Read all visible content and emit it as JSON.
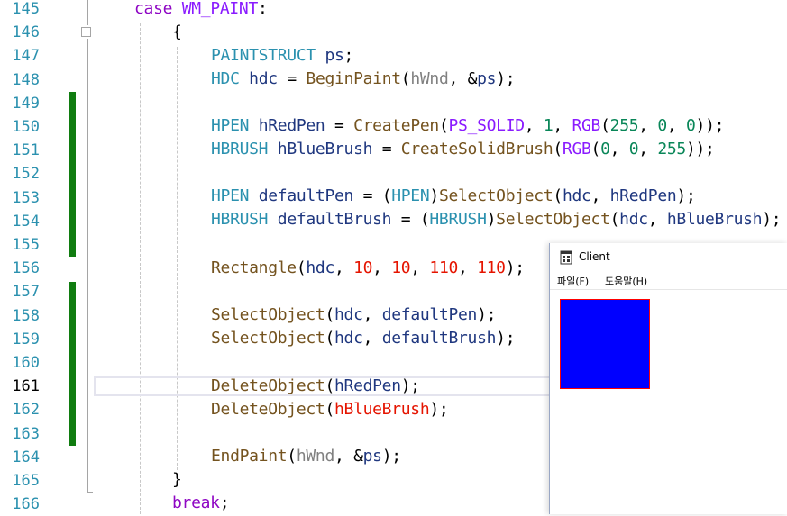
{
  "editor": {
    "line_numbers": [
      "145",
      "146",
      "147",
      "148",
      "149",
      "150",
      "151",
      "152",
      "153",
      "154",
      "155",
      "156",
      "157",
      "158",
      "159",
      "160",
      "161",
      "162",
      "163",
      "164",
      "165",
      "166"
    ],
    "current_line": "161",
    "code": {
      "l145_kw": "case",
      "l145_macro": "WM_PAINT",
      "l145_colon": ":",
      "l146": "{",
      "l147_type": "PAINTSTRUCT",
      "l147_var": "ps",
      "l147_end": ";",
      "l148_type": "HDC",
      "l148_var": "hdc",
      "l148_eq": " = ",
      "l148_fn": "BeginPaint",
      "l148_open": "(",
      "l148_arg1": "hWnd",
      "l148_sep": ", &",
      "l148_arg2": "ps",
      "l148_end": ");",
      "l150_type": "HPEN",
      "l150_var": "hRedPen",
      "l150_eq": " = ",
      "l150_fn": "CreatePen",
      "l150_open": "(",
      "l150_macro": "PS_SOLID",
      "l150_c1": ", ",
      "l150_n1": "1",
      "l150_c2": ", ",
      "l150_rgb": "RGB",
      "l150_p": "(",
      "l150_n2": "255",
      "l150_c3": ", ",
      "l150_n3": "0",
      "l150_c4": ", ",
      "l150_n4": "0",
      "l150_end": "));",
      "l151_type": "HBRUSH",
      "l151_var": "hBlueBrush",
      "l151_eq": " = ",
      "l151_fn": "CreateSolidBrush",
      "l151_open": "(",
      "l151_rgb": "RGB",
      "l151_p": "(",
      "l151_n1": "0",
      "l151_c1": ", ",
      "l151_n2": "0",
      "l151_c2": ", ",
      "l151_n3": "255",
      "l151_end": "));",
      "l153_type": "HPEN",
      "l153_var": "defaultPen",
      "l153_eq": " = (",
      "l153_cast": "HPEN",
      "l153_close": ")",
      "l153_fn": "SelectObject",
      "l153_open": "(",
      "l153_a1": "hdc",
      "l153_c": ", ",
      "l153_a2": "hRedPen",
      "l153_end": ");",
      "l154_type": "HBRUSH",
      "l154_var": "defaultBrush",
      "l154_eq": " = (",
      "l154_cast": "HBRUSH",
      "l154_close": ")",
      "l154_fn": "SelectObject",
      "l154_open": "(",
      "l154_a1": "hdc",
      "l154_c": ", ",
      "l154_a2": "hBlueBrush",
      "l154_end": ");",
      "l156_fn": "Rectangle",
      "l156_open": "(",
      "l156_a1": "hdc",
      "l156_c1": ", ",
      "l156_n1": "10",
      "l156_c2": ", ",
      "l156_n2": "10",
      "l156_c3": ", ",
      "l156_n3": "110",
      "l156_c4": ", ",
      "l156_n4": "110",
      "l156_end": ");",
      "l158_fn": "SelectObject",
      "l158_open": "(",
      "l158_a1": "hdc",
      "l158_c": ", ",
      "l158_a2": "defaultPen",
      "l158_end": ");",
      "l159_fn": "SelectObject",
      "l159_open": "(",
      "l159_a1": "hdc",
      "l159_c": ", ",
      "l159_a2": "defaultBrush",
      "l159_end": ");",
      "l161_fn": "DeleteObject",
      "l161_open": "(",
      "l161_a1": "hRedPen",
      "l161_end": ");",
      "l162_fn": "DeleteObject",
      "l162_open": "(",
      "l162_a1": "hBlueBrush",
      "l162_end": ");",
      "l164_fn": "EndPaint",
      "l164_open": "(",
      "l164_a1": "hWnd",
      "l164_sep": ", &",
      "l164_a2": "ps",
      "l164_end": ");",
      "l165": "}",
      "l166_kw": "break",
      "l166_end": ";"
    },
    "colors": {
      "change_bar": "#107c10",
      "keyword": "#8f08c4",
      "type": "#2b91af",
      "function": "#74531f",
      "number": "#098658",
      "error": "#e51400"
    }
  },
  "client_window": {
    "title": "Client",
    "icon": "app-window-icon",
    "menu": [
      "파일(F)",
      "도움말(H)"
    ],
    "drawn_rectangle": {
      "fill": "#0000ff",
      "border": "#ff0000"
    }
  }
}
